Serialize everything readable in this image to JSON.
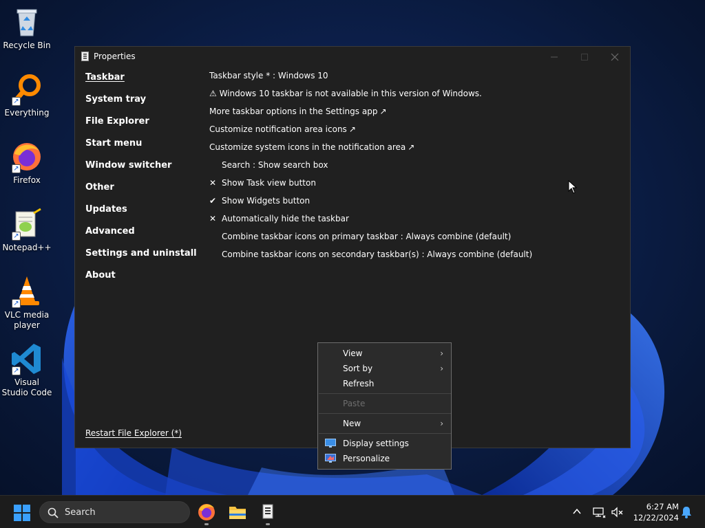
{
  "desktop": {
    "icons": [
      {
        "label": "Recycle Bin",
        "icon": "recycle-bin-icon"
      },
      {
        "label": "Everything",
        "icon": "magnifier-icon"
      },
      {
        "label": "Firefox",
        "icon": "firefox-icon"
      },
      {
        "label": "Notepad++",
        "icon": "notepad-plus-plus-icon"
      },
      {
        "label": "VLC media player",
        "icon": "vlc-cone-icon"
      },
      {
        "label": "Visual Studio Code",
        "icon": "vscode-icon"
      }
    ]
  },
  "window": {
    "title": "Properties",
    "nav": [
      {
        "label": "Taskbar",
        "active": true
      },
      {
        "label": "System tray"
      },
      {
        "label": "File Explorer"
      },
      {
        "label": "Start menu"
      },
      {
        "label": "Window switcher"
      },
      {
        "label": "Other"
      },
      {
        "label": "Updates"
      },
      {
        "label": "Advanced"
      },
      {
        "label": "Settings and uninstall"
      },
      {
        "label": "About"
      }
    ],
    "restart_link": "Restart File Explorer (*)",
    "settings": [
      {
        "text": "Taskbar style * : Windows 10",
        "mark": ""
      },
      {
        "text": "⚠ Windows 10 taskbar is not available in this version of Windows.",
        "mark": ""
      },
      {
        "text": "More taskbar options in the Settings app",
        "link": "↗"
      },
      {
        "text": "Customize notification area icons",
        "link": "↗"
      },
      {
        "text": "Customize system icons in the notification area",
        "link": "↗"
      },
      {
        "text": "Search : Show search box",
        "mark": " "
      },
      {
        "text": "Show Task view button",
        "mark": "✕"
      },
      {
        "text": "Show Widgets button",
        "mark": "✔"
      },
      {
        "text": "Automatically hide the taskbar",
        "mark": "✕"
      },
      {
        "text": "Combine taskbar icons on primary taskbar : Always combine (default)",
        "mark": " "
      },
      {
        "text": "Combine taskbar icons on secondary taskbar(s) : Always combine (default)",
        "mark": " "
      }
    ]
  },
  "context_menu": {
    "items": [
      {
        "label": "View",
        "submenu": "›"
      },
      {
        "label": "Sort by",
        "submenu": "›"
      },
      {
        "label": "Refresh"
      },
      {
        "label": "Paste",
        "disabled": true
      },
      {
        "label": "New",
        "submenu": "›"
      },
      {
        "label": "Display settings",
        "icon": "display-settings-icon"
      },
      {
        "label": "Personalize",
        "icon": "personalize-icon"
      }
    ]
  },
  "taskbar": {
    "search_label": "Search",
    "apps": [
      "firefox-icon",
      "file-explorer-icon",
      "properties-app-icon"
    ],
    "clock_time": "6:27 AM",
    "clock_date": "12/22/2024"
  },
  "colors": {
    "window_bg": "#202020",
    "menu_bg": "#2b2b2b",
    "taskbar_bg": "#1c1c1c",
    "accent": "#1a73e8"
  }
}
